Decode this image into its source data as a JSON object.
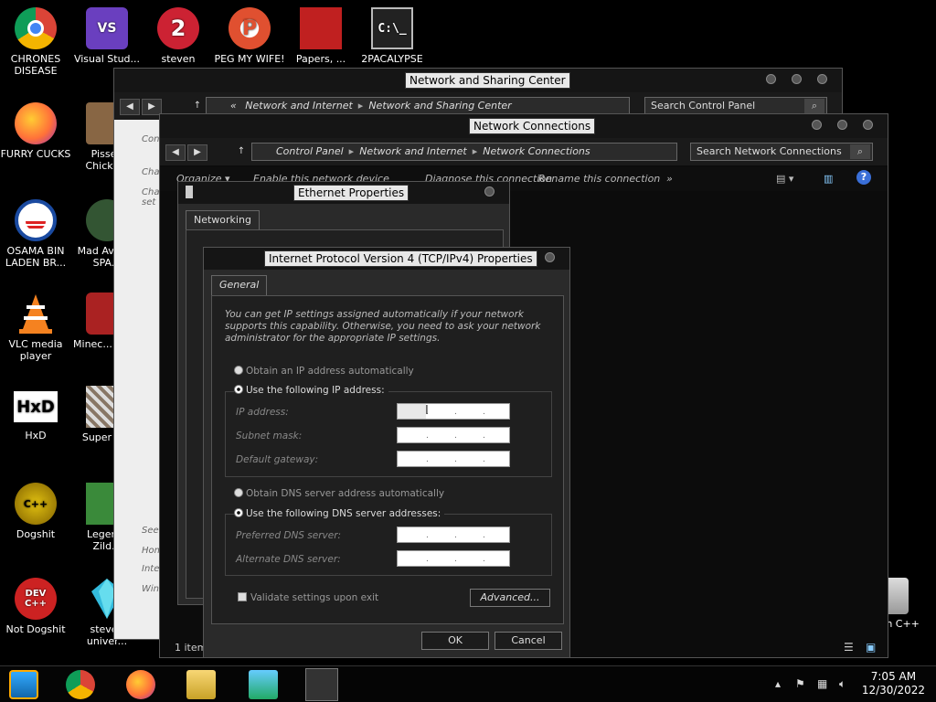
{
  "desktop_icons": [
    {
      "label": "CHRONES DISEASE",
      "icon": "chrome-icon",
      "color": "#db4437"
    },
    {
      "label": "FURRY CUCKS",
      "icon": "firefox-icon",
      "color": "#ff7139"
    },
    {
      "label": "OSAMA BIN LADEN BR...",
      "icon": "obama-logo-icon",
      "color": "#1a4aa0"
    },
    {
      "label": "VLC media player",
      "icon": "vlc-cone-icon",
      "color": "#f58220"
    },
    {
      "label": "HxD",
      "icon": "hxd-icon",
      "color": "#ffffff"
    },
    {
      "label": "Dogshit",
      "icon": "codeblocks-icon",
      "color": "#e0c010"
    },
    {
      "label": "Not Dogshit",
      "icon": "devcpp-icon",
      "color": "#cc2222"
    },
    {
      "label": "Visual Stud...",
      "icon": "visual-studio-icon",
      "color": "#6a3fbf"
    },
    {
      "label": "Pissed Chicke...",
      "icon": "game-icon",
      "color": "#886644"
    },
    {
      "label": "Mad Av... IN SPA...",
      "icon": "angry-birds-space-icon",
      "color": "#335533"
    },
    {
      "label": "Minec... Birds",
      "icon": "angry-birds-icon",
      "color": "#aa2222"
    },
    {
      "label": "Super H...",
      "icon": "game-icon",
      "color": "#887766"
    },
    {
      "label": "Legen... Zild...",
      "icon": "mario-icon",
      "color": "#3a8a3a"
    },
    {
      "label": "steven univer...",
      "icon": "gem-icon",
      "color": "#33bbdd"
    },
    {
      "label": "steven",
      "icon": "steven-icon",
      "color": "#cc2233"
    },
    {
      "label": "PEG MY WIFE!",
      "icon": "peg-icon",
      "color": "#e05030"
    },
    {
      "label": "Papers, ...",
      "icon": "papers-please-icon",
      "color": "#c02020"
    },
    {
      "label": "2PACALYPSE",
      "icon": "cmd-icon",
      "color": "#222222"
    }
  ],
  "recycle_bin_label": "...on C++",
  "nsc_window": {
    "title": "Network and Sharing Center",
    "address": [
      "Network and Internet",
      "Network and Sharing Center"
    ],
    "address_prefix": "«",
    "search_placeholder": "Search Control Panel",
    "side_links": [
      "Con",
      "Cha",
      "Cha set",
      "See",
      "Hom",
      "Inte",
      "Win"
    ]
  },
  "nc_window": {
    "title": "Network Connections",
    "address": [
      "Control Panel",
      "Network and Internet",
      "Network Connections"
    ],
    "search_placeholder": "Search Network Connections",
    "toolbar": [
      "Organize ▾",
      "Enable this network device",
      "Diagnose this connection",
      "Rename this connection",
      "»"
    ],
    "status": "1 item"
  },
  "eth_window": {
    "title": "Ethernet Properties",
    "tab": "Networking"
  },
  "ipv4_dialog": {
    "title": "Internet Protocol Version 4 (TCP/IPv4) Properties",
    "tab": "General",
    "description": "You can get IP settings assigned automatically if your network supports this capability. Otherwise, you need to ask your network administrator for the appropriate IP settings.",
    "radio_auto_ip": "Obtain an IP address automatically",
    "radio_manual_ip": "Use the following IP address:",
    "ip_label": "IP address:",
    "subnet_label": "Subnet mask:",
    "gateway_label": "Default gateway:",
    "radio_auto_dns": "Obtain DNS server address automatically",
    "radio_manual_dns": "Use the following DNS server addresses:",
    "preferred_dns_label": "Preferred DNS server:",
    "alternate_dns_label": "Alternate DNS server:",
    "validate_label": "Validate settings upon exit",
    "advanced_label": "Advanced...",
    "ok_label": "OK",
    "cancel_label": "Cancel"
  },
  "taskbar": {
    "time": "7:05 AM",
    "date": "12/30/2022"
  }
}
